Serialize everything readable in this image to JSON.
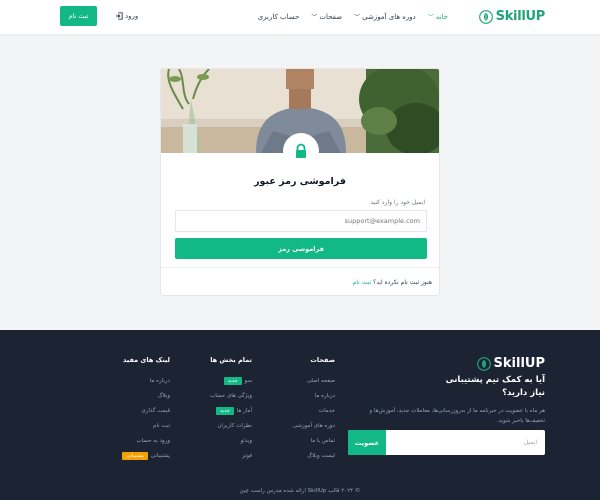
{
  "header": {
    "logo": "SkillUP",
    "nav": [
      {
        "label": "خانه",
        "has_dropdown": true,
        "active": true
      },
      {
        "label": "دوره های آموزشی",
        "has_dropdown": true,
        "active": false
      },
      {
        "label": "صفحات",
        "has_dropdown": true,
        "active": false
      },
      {
        "label": "حساب کاربری",
        "has_dropdown": false,
        "active": false
      }
    ],
    "signin_label": "ورود",
    "signup_label": "ثبت نام"
  },
  "card": {
    "title": "فراموشی رمز عبور",
    "email_label": "ایمیل خود را وارد کنید",
    "email_placeholder": "support@example.com",
    "submit_label": "فراموشی رمز",
    "footer_text": "هنوز ثبت نام نکرده اید؟",
    "footer_link": "ثبت نام"
  },
  "footer": {
    "logo": "SkillUP",
    "heading": "آیا به کمک تیم پشتیبانی نیاز دارید؟",
    "description": "هر ماه با عضویت در خبرنامه ما از به‌روزرسانی‌ها، معاملات جدید، آموزش‌ها و تخفیف‌ها باخبر شوید.",
    "newsletter_placeholder": "ایمیل",
    "newsletter_button": "عضویت",
    "columns": [
      {
        "title": "صفحات",
        "items": [
          {
            "label": "صفحه اصلی"
          },
          {
            "label": "درباره ما"
          },
          {
            "label": "خدمات"
          },
          {
            "label": "دوره های آموزشی"
          },
          {
            "label": "تماس با ما"
          },
          {
            "label": "لیست وبلاگ"
          }
        ]
      },
      {
        "title": "تمام بخش ها",
        "items": [
          {
            "label": "سو",
            "badge": "جدید"
          },
          {
            "label": "ویژگی های حساب"
          },
          {
            "label": "آمار ها",
            "badge": "جدید"
          },
          {
            "label": "نظرات کاربران"
          },
          {
            "label": "ویدئو"
          },
          {
            "label": "فوتر"
          }
        ]
      },
      {
        "title": "لینک های مفید",
        "items": [
          {
            "label": "درباره ما"
          },
          {
            "label": "وبلاگ"
          },
          {
            "label": "قیمت گذاری"
          },
          {
            "label": "ثبت نام"
          },
          {
            "label": "ورود به حساب"
          },
          {
            "label": "پشتیبانی",
            "badge": "پشتیبانی"
          }
        ]
      }
    ],
    "copyright": "© ۲۰۲۴ قالب SkillUp ارائه شده مدرس راست چین"
  },
  "colors": {
    "primary": "#12b886",
    "footer_bg": "#1c2434",
    "badge_new": "#12b886",
    "badge_support": "#f59f00"
  }
}
